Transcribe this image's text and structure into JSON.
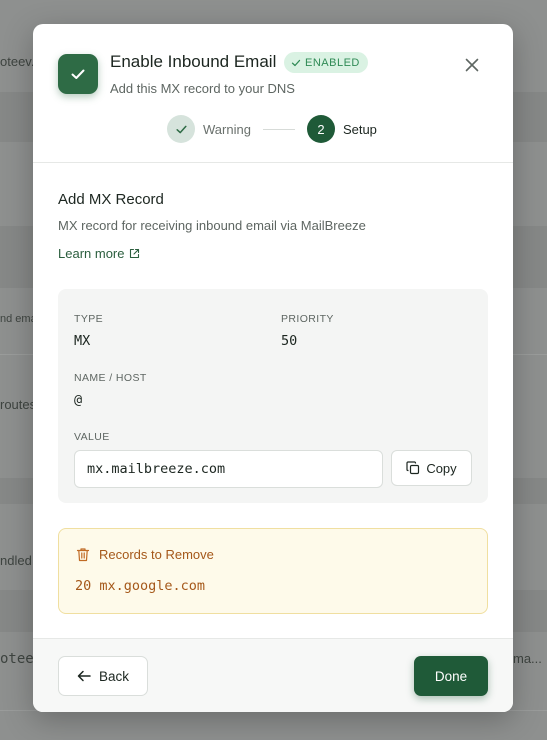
{
  "background": {
    "fragments": [
      "oteev.",
      "nd ema",
      "routes",
      "ndled",
      "oteev.",
      "ma..."
    ]
  },
  "dialog": {
    "title": "Enable Inbound Email",
    "badge": "ENABLED",
    "subtitle": "Add this MX record to your DNS",
    "steps": [
      {
        "label": "Warning",
        "state": "done"
      },
      {
        "number": "2",
        "label": "Setup",
        "state": "active"
      }
    ]
  },
  "section": {
    "title": "Add MX Record",
    "description": "MX record for receiving inbound email via MailBreeze",
    "learn_more": "Learn more"
  },
  "record": {
    "type_label": "TYPE",
    "type_value": "MX",
    "priority_label": "PRIORITY",
    "priority_value": "50",
    "name_label": "NAME / HOST",
    "name_value": "@",
    "value_label": "VALUE",
    "value": "mx.mailbreeze.com",
    "copy_label": "Copy"
  },
  "remove": {
    "title": "Records to Remove",
    "record": "20 mx.google.com"
  },
  "footer": {
    "back_label": "Back",
    "done_label": "Done"
  },
  "colors": {
    "brand": "#1f5a38",
    "success_badge_bg": "#daf2e3",
    "success_badge_fg": "#2f8a55",
    "warning_bg": "#fefaea",
    "warning_fg": "#a5581a"
  },
  "icons": {
    "header": "check-icon",
    "close": "close-icon",
    "external": "external-link-icon",
    "copy": "copy-icon",
    "trash": "trash-icon",
    "back": "arrow-left-icon"
  }
}
